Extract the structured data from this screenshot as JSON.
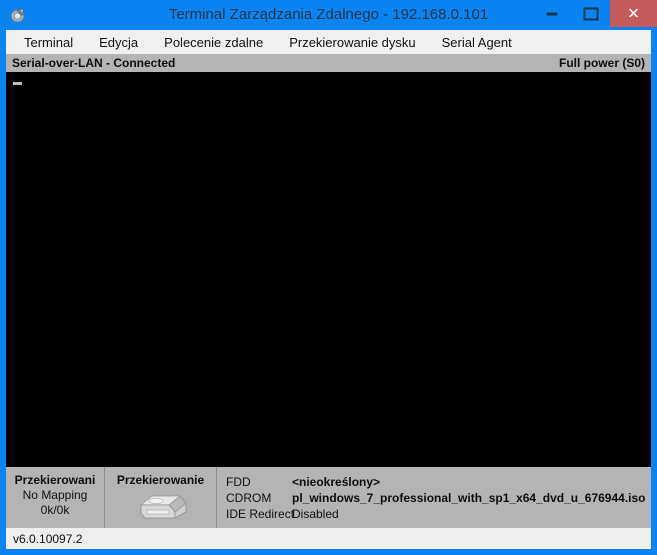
{
  "window": {
    "title": "Terminal Zarządzania Zdalnego - 192.168.0.101",
    "icon": "remote-terminal-icon",
    "accent_color": "#0a84f0",
    "close_color": "#c75b5b",
    "controls": {
      "minimize": "–",
      "maximize": "□",
      "close": "✕"
    }
  },
  "menubar": {
    "items": [
      {
        "label": "Terminal"
      },
      {
        "label": "Edycja"
      },
      {
        "label": "Polecenie zdalne"
      },
      {
        "label": "Przekierowanie dysku"
      },
      {
        "label": "Serial Agent"
      }
    ]
  },
  "status_strip": {
    "connection": "Serial-over-LAN - Connected",
    "power": "Full power (S0)"
  },
  "console": {
    "background": "#000000",
    "cursor": "_",
    "content": ""
  },
  "redirection": {
    "mapping": {
      "heading": "Przekierowani",
      "state": "No Mapping",
      "throughput": "0k/0k"
    },
    "device": {
      "heading": "Przekierowanie",
      "icon": "disk-drive-icon"
    },
    "info": [
      {
        "label": "FDD",
        "value": "<nieokreślony>",
        "bold": true
      },
      {
        "label": "CDROM",
        "value": "pl_windows_7_professional_with_sp1_x64_dvd_u_676944.iso",
        "bold": true
      },
      {
        "label": "IDE Redirect",
        "value": "Disabled",
        "bold": false
      }
    ]
  },
  "version_bar": {
    "version": "v6.0.10097.2"
  }
}
